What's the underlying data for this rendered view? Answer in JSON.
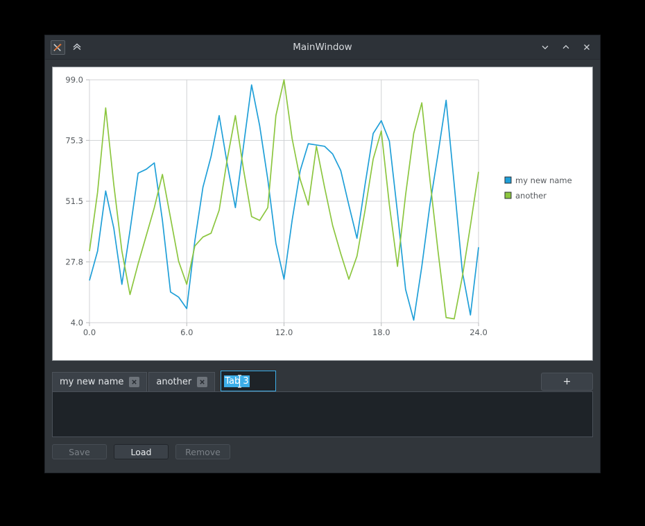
{
  "window": {
    "title": "MainWindow",
    "icon": "app-icon",
    "collapse_icon": "chevron-double-up-icon",
    "controls": {
      "minimize": "chevron-down-icon",
      "maximize": "chevron-up-icon",
      "close": "close-icon"
    }
  },
  "tabs": {
    "items": [
      {
        "label": "my new name",
        "close_icon": "close-icon",
        "editing": false
      },
      {
        "label": "another",
        "close_icon": "close-icon",
        "editing": false
      }
    ],
    "editing_tab": {
      "value": "Tab 3",
      "selected": true,
      "cursor": "i-beam-cursor"
    },
    "add_label": "+"
  },
  "list": {
    "items": []
  },
  "buttons": [
    {
      "label": "Save",
      "enabled": false
    },
    {
      "label": "Load",
      "enabled": true
    },
    {
      "label": "Remove",
      "enabled": false
    }
  ],
  "chart_data": {
    "type": "line",
    "title": "",
    "xlabel": "",
    "ylabel": "",
    "xlim": [
      0.0,
      24.0
    ],
    "ylim": [
      4.0,
      99.0
    ],
    "xticks": [
      0.0,
      6.0,
      12.0,
      18.0,
      24.0
    ],
    "xtick_labels": [
      "0.0",
      "6.0",
      "12.0",
      "18.0",
      "24.0"
    ],
    "yticks": [
      4.0,
      27.8,
      51.5,
      75.3,
      99.0
    ],
    "ytick_labels": [
      "4.0",
      "27.8",
      "51.5",
      "75.3",
      "99.0"
    ],
    "grid": true,
    "legend_position": "right",
    "x": [
      0,
      0.5,
      1,
      1.5,
      2,
      2.5,
      3,
      3.5,
      4,
      4.5,
      5,
      5.5,
      6,
      6.5,
      7,
      7.5,
      8,
      8.5,
      9,
      9.5,
      10,
      10.5,
      11,
      11.5,
      12,
      12.5,
      13,
      13.5,
      14,
      14.5,
      15,
      15.5,
      16,
      16.5,
      17,
      17.5,
      18,
      18.5,
      19,
      19.5,
      20,
      20.5,
      21,
      21.5,
      22,
      22.5,
      23,
      23.5,
      24
    ],
    "series": [
      {
        "name": "my new name",
        "color": "#1f9fd8",
        "values": [
          20.5,
          32.0,
          55.5,
          41.0,
          19.0,
          40.0,
          62.5,
          64.0,
          66.5,
          44.0,
          16.0,
          14.0,
          9.5,
          36.0,
          57.0,
          69.0,
          85.0,
          66.0,
          49.0,
          73.0,
          97.0,
          81.0,
          60.0,
          35.0,
          21.0,
          44.0,
          63.5,
          74.0,
          73.5,
          73.0,
          70.0,
          63.5,
          50.0,
          37.0,
          58.0,
          78.0,
          83.0,
          75.0,
          47.0,
          17.0,
          5.0,
          26.0,
          50.0,
          70.0,
          91.0,
          58.0,
          24.0,
          7.0,
          33.5
        ]
      },
      {
        "name": "another",
        "color": "#8cc63f",
        "values": [
          32.0,
          55.0,
          88.0,
          58.0,
          32.0,
          15.0,
          27.0,
          38.0,
          49.0,
          62.0,
          45.0,
          28.0,
          19.0,
          34.0,
          37.5,
          39.0,
          48.0,
          68.0,
          85.0,
          64.0,
          45.5,
          44.0,
          49.0,
          85.0,
          99.0,
          76.0,
          60.0,
          50.0,
          73.0,
          57.0,
          42.0,
          31.0,
          21.0,
          30.0,
          48.0,
          68.0,
          79.0,
          50.0,
          26.0,
          54.0,
          78.0,
          90.0,
          60.0,
          32.0,
          6.0,
          5.5,
          22.0,
          42.0,
          63.0
        ]
      }
    ]
  }
}
